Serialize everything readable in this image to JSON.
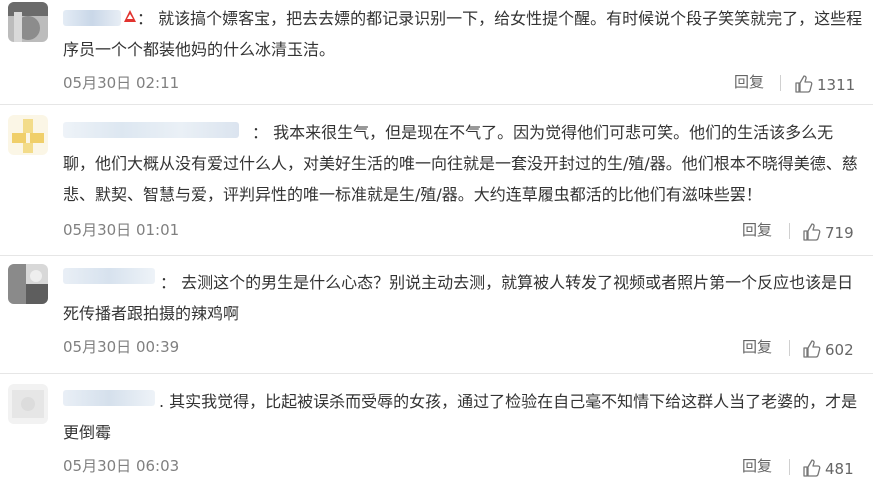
{
  "comments": [
    {
      "text": "：  就该搞个嫖客宝，把去去嫖的都记录识别一下，给女性提个醒。有时候说个段子笑笑就完了，这些程序员一个个都装他妈的什么冰清玉洁。",
      "time": "05月30日 02:11",
      "reply_label": "回复",
      "likes": "1311"
    },
    {
      "text": "：  我本来很生气，但是现在不气了。因为觉得他们可悲可笑。他们的生活该多么无聊，他们大概从没有爱过什么人，对美好生活的唯一向往就是一套没开封过的生/殖/器。他们根本不晓得美德、慈悲、默契、智慧与爱，评判异性的唯一标准就是生/殖/器。大约连草履虫都活的比他们有滋味些罢！",
      "time": "05月30日 01:01",
      "reply_label": "回复",
      "likes": "719"
    },
    {
      "text": "：  去测这个的男生是什么心态？别说主动去测，就算被人转发了视频或者照片第一个反应也该是日死传播者跟拍摄的辣鸡啊",
      "time": "05月30日 00:39",
      "reply_label": "回复",
      "likes": "602"
    },
    {
      "text": ".  其实我觉得，比起被误杀而受辱的女孩，通过了检验在自己毫不知情下给这群人当了老婆的，才是更倒霉",
      "time": "05月30日 06:03",
      "reply_label": "回复",
      "likes": "481"
    }
  ],
  "icons": {
    "badge": "red-badge-icon",
    "like": "thumbs-up-icon"
  },
  "colors": {
    "text": "#333333",
    "meta": "#808080",
    "divider": "#e6e6e6",
    "badge": "#e2332f"
  }
}
